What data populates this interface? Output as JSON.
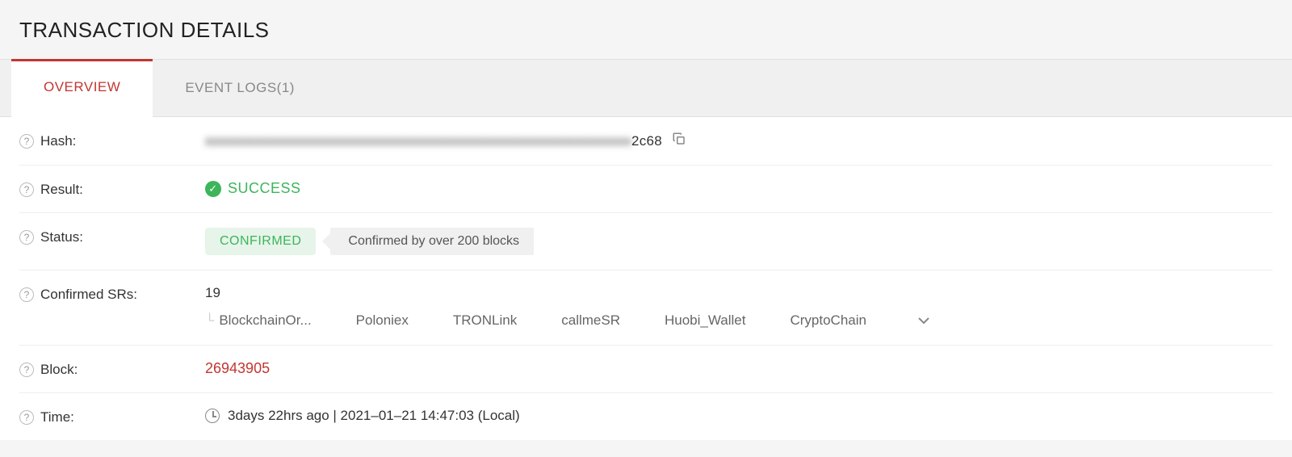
{
  "page_title": "TRANSACTION DETAILS",
  "tabs": {
    "overview": "OVERVIEW",
    "event_logs": "EVENT LOGS(1)"
  },
  "fields": {
    "hash": {
      "label": "Hash:",
      "value_obscured_prefix": "xxxxxxxxxxxxxxxxxxxxxxxxxxxxxxxxxxxxxxxxxxxxxxxxxxxxxxxxxxxx",
      "value_visible_suffix": "2c68"
    },
    "result": {
      "label": "Result:",
      "value": "SUCCESS"
    },
    "status": {
      "label": "Status:",
      "badge": "CONFIRMED",
      "tooltip": "Confirmed by over 200 blocks"
    },
    "confirmed_srs": {
      "label": "Confirmed SRs:",
      "count": "19",
      "list": [
        "BlockchainOr...",
        "Poloniex",
        "TRONLink",
        "callmeSR",
        "Huobi_Wallet",
        "CryptoChain"
      ]
    },
    "block": {
      "label": "Block:",
      "value": "26943905"
    },
    "time": {
      "label": "Time:",
      "value": "3days 22hrs ago | 2021–01–21 14:47:03 (Local)"
    }
  }
}
